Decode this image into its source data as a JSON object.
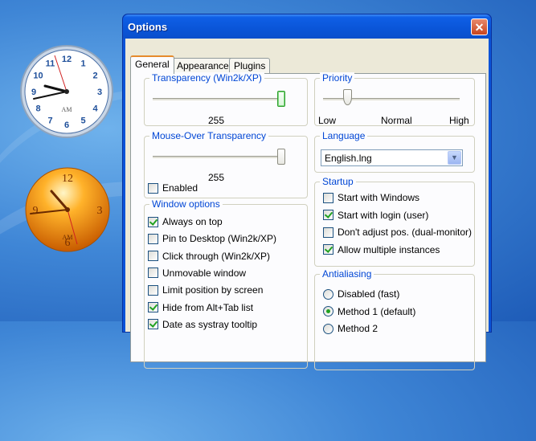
{
  "window": {
    "title": "Options",
    "close_glyph": "✕"
  },
  "tabs": [
    {
      "label": "General",
      "active": true
    },
    {
      "label": "Appearance",
      "active": false
    },
    {
      "label": "Plugins",
      "active": false
    }
  ],
  "transparency": {
    "title": "Transparency (Win2k/XP)",
    "value": "255",
    "level": 1.0
  },
  "mouse_over": {
    "title": "Mouse-Over Transparency",
    "value": "255",
    "level": 1.0,
    "enabled": {
      "label": "Enabled",
      "checked": false
    }
  },
  "window_options": {
    "title": "Window options",
    "items": [
      {
        "label": "Always on top",
        "checked": true
      },
      {
        "label": "Pin to Desktop (Win2k/XP)",
        "checked": false
      },
      {
        "label": "Click through (Win2k/XP)",
        "checked": false
      },
      {
        "label": "Unmovable window",
        "checked": false
      },
      {
        "label": "Limit position by screen",
        "checked": false
      },
      {
        "label": "Hide from Alt+Tab list",
        "checked": true
      },
      {
        "label": "Date as systray tooltip",
        "checked": true
      }
    ]
  },
  "priority": {
    "title": "Priority",
    "labels": [
      "Low",
      "Normal",
      "High"
    ],
    "level": 0.2
  },
  "language": {
    "title": "Language",
    "value": "English.lng"
  },
  "startup": {
    "title": "Startup",
    "items": [
      {
        "label": "Start with Windows",
        "checked": false
      },
      {
        "label": "Start with login (user)",
        "checked": true
      },
      {
        "label": "Don't adjust pos. (dual-monitor)",
        "checked": false
      },
      {
        "label": "Allow multiple instances",
        "checked": true
      }
    ]
  },
  "antialiasing": {
    "title": "Antialiasing",
    "items": [
      {
        "label": "Disabled (fast)",
        "checked": false
      },
      {
        "label": "Method 1 (default)",
        "checked": true
      },
      {
        "label": "Method 2",
        "checked": false
      }
    ]
  },
  "clocks": [
    {
      "name": "blue-clock",
      "label": "AM",
      "numerals": [
        "12",
        "1",
        "2",
        "3",
        "4",
        "5",
        "6",
        "7",
        "8",
        "9",
        "10",
        "11"
      ]
    },
    {
      "name": "orange-clock",
      "label": "AM",
      "numerals": [
        "12",
        "3",
        "6",
        "9"
      ]
    }
  ],
  "colors": {
    "titlebar": "#0a55d8",
    "accent_text": "#0046d5",
    "check": "#21a121",
    "tab_highlight": "#e68b2c"
  }
}
